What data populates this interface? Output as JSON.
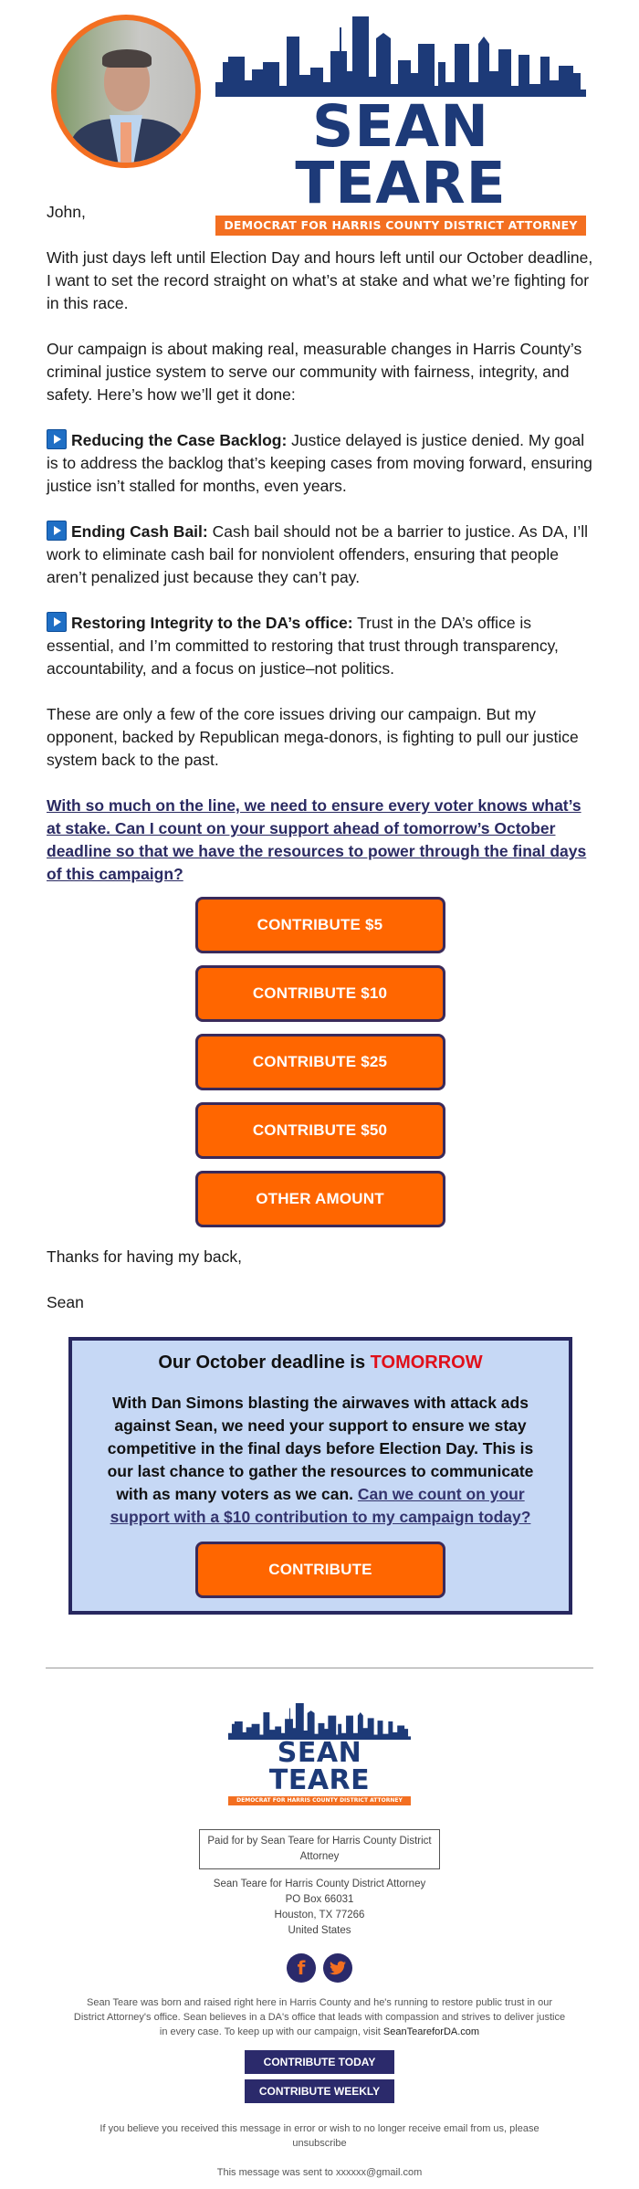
{
  "header": {
    "photo_alt": "Sean Teare portrait",
    "logo_name": "SEAN TEARE",
    "logo_tagline": "DEMOCRAT FOR HARRIS COUNTY DISTRICT ATTORNEY"
  },
  "body": {
    "greeting": "John,",
    "para1": "With just days left until Election Day and hours left until our October deadline, I want to set the record straight on what’s at stake and what we’re fighting for in this race.",
    "para2": "Our campaign is about making real, measurable changes in Harris County’s criminal justice system to serve our community with fairness, integrity, and safety. Here’s how we’ll get it done:",
    "bullets": [
      {
        "icon": "play-button-icon",
        "title": "Reducing the Case Backlog:",
        "text": " Justice delayed is justice denied. My goal is to address the backlog that’s keeping cases from moving forward, ensuring justice isn’t stalled for months, even years."
      },
      {
        "icon": "play-button-icon",
        "title": "Ending Cash Bail:",
        "text": " Cash bail should not be a barrier to justice. As DA, I’ll work to eliminate cash bail for nonviolent offenders, ensuring that people aren’t penalized just because they can’t pay."
      },
      {
        "icon": "play-button-icon",
        "title": "Restoring Integrity to the DA’s office:",
        "text": " Trust in the DA’s office is essential, and I’m committed to restoring that trust through transparency, accountability, and a focus on justice–not politics."
      }
    ],
    "para3": "These are only a few of the core issues driving our campaign. But my opponent, backed by Republican mega-donors, is fighting to pull our justice system back to the past.",
    "cta_link": "With so much on the line, we need to ensure every voter knows what’s at stake. Can I count on your support ahead of tomorrow’s October deadline so that we have the resources to power through the final days of this campaign?",
    "buttons": [
      "CONTRIBUTE $5",
      "CONTRIBUTE $10",
      "CONTRIBUTE $25",
      "CONTRIBUTE $50",
      "OTHER AMOUNT"
    ],
    "signoff": "Thanks for having my back,",
    "signature": "Sean"
  },
  "deadline_box": {
    "title_prefix": "Our October deadline is ",
    "title_highlight": "TOMORROW",
    "text": "With Dan Simons blasting the airwaves with attack ads against Sean, we need your support to ensure we stay competitive in the final days before Election Day. This is our last chance to gather the resources to communicate with as many voters as we can. ",
    "link": "Can we count on your support with a $10 contribution to my campaign today?",
    "button": "CONTRIBUTE"
  },
  "footer": {
    "logo_name": "SEAN TEARE",
    "logo_tagline": "DEMOCRAT FOR HARRIS COUNTY DISTRICT ATTORNEY",
    "paid_for": "Paid for by Sean Teare for Harris County District Attorney",
    "address": [
      "Sean Teare for Harris County District Attorney",
      "PO Box 66031",
      "Houston, TX 77266",
      "United States"
    ],
    "social": [
      {
        "icon": "facebook-icon",
        "glyph": "f"
      },
      {
        "icon": "twitter-icon",
        "glyph": "🐦"
      }
    ],
    "about": "Sean Teare was born and raised right here in Harris County and he's running to restore public trust in our District Attorney's office. Sean believes in a DA's office that leads with compassion and strives to deliver justice in every case. To keep up with our campaign, visit ",
    "about_site": "SeanTeareforDA.com",
    "buttons": [
      "CONTRIBUTE TODAY",
      "CONTRIBUTE WEEKLY"
    ],
    "unsubscribe": "If you believe you received this message in error or wish to no longer receive email from us, please unsubscribe",
    "sent_to": "This message was sent to xxxxxx@gmail.com"
  },
  "colors": {
    "brand_navy": "#1d3a78",
    "brand_orange": "#f36f21",
    "button_orange": "#ff6600",
    "button_border": "#3a2a5a",
    "deadline_bg": "#c6d8f5",
    "deadline_border": "#27275f",
    "alert_red": "#e0101a",
    "footer_button": "#2b2a6b"
  }
}
